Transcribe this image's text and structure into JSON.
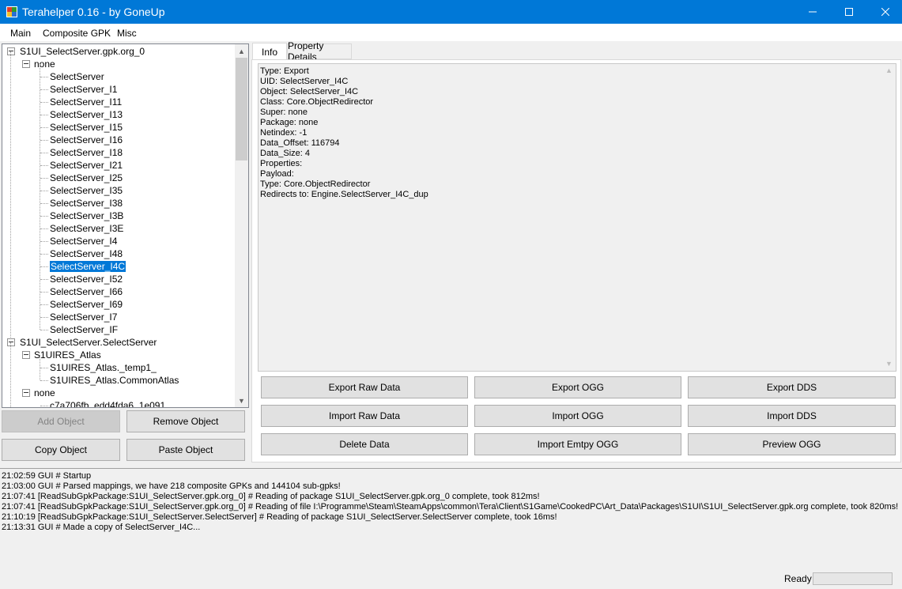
{
  "window": {
    "title": "Terahelper 0.16 - by GoneUp"
  },
  "menu": [
    "Main",
    "Composite GPK",
    "Misc"
  ],
  "tree": {
    "root1": "S1UI_SelectServer.gpk.org_0",
    "root1_child": "none",
    "leaves": [
      "SelectServer",
      "SelectServer_I1",
      "SelectServer_I11",
      "SelectServer_I13",
      "SelectServer_I15",
      "SelectServer_I16",
      "SelectServer_I18",
      "SelectServer_I21",
      "SelectServer_I25",
      "SelectServer_I35",
      "SelectServer_I38",
      "SelectServer_I3B",
      "SelectServer_I3E",
      "SelectServer_I4",
      "SelectServer_I48",
      "SelectServer_I4C",
      "SelectServer_I52",
      "SelectServer_I66",
      "SelectServer_I69",
      "SelectServer_I7",
      "SelectServer_IF"
    ],
    "selected_index": 15,
    "root2": "S1UI_SelectServer.SelectServer",
    "root2_child": "S1UIRES_Atlas",
    "root2_leaves": [
      "S1UIRES_Atlas._temp1_",
      "S1UIRES_Atlas.CommonAtlas"
    ],
    "root2_child2": "none",
    "partial": "c7a706fb_edd4fda6_1e091..."
  },
  "left_buttons": {
    "add": "Add Object",
    "remove": "Remove Object",
    "copy": "Copy Object",
    "paste": "Paste Object"
  },
  "tabs": [
    "Info",
    "Property Details"
  ],
  "info_lines": [
    "Type: Export",
    "UID: SelectServer_I4C",
    "Object: SelectServer_I4C",
    "Class: Core.ObjectRedirector",
    "Super: none",
    "Package: none",
    "Netindex: -1",
    "Data_Offset: 116794",
    "Data_Size: 4",
    "Properties:",
    "Payload:",
    "Type: Core.ObjectRedirector",
    "Redirects to: Engine.SelectServer_I4C_dup"
  ],
  "action_buttons": {
    "export_raw": "Export Raw Data",
    "export_ogg": "Export OGG",
    "export_dds": "Export DDS",
    "import_raw": "Import Raw Data",
    "import_ogg": "Import OGG",
    "import_dds": "Import DDS",
    "delete": "Delete Data",
    "import_empty_ogg": "Import Emtpy OGG",
    "preview_ogg": "Preview OGG"
  },
  "log_lines": [
    "21:02:59 GUI # Startup",
    "21:03:00 GUI # Parsed mappings, we have 218 composite GPKs and 144104 sub-gpks!",
    "21:07:41 [ReadSubGpkPackage:S1UI_SelectServer.gpk.org_0] # Reading of package S1UI_SelectServer.gpk.org_0 complete, took 812ms!",
    "21:07:41 [ReadSubGpkPackage:S1UI_SelectServer.gpk.org_0] # Reading of file I:\\Programme\\Steam\\SteamApps\\common\\Tera\\Client\\S1Game\\CookedPC\\Art_Data\\Packages\\S1UI\\S1UI_SelectServer.gpk.org complete, took 820ms!",
    "21:10:19 [ReadSubGpkPackage:S1UI_SelectServer.SelectServer] # Reading of package S1UI_SelectServer.SelectServer complete, took 16ms!",
    "21:13:31 GUI # Made a copy of SelectServer_I4C..."
  ],
  "status": {
    "text": "Ready"
  },
  "colors": {
    "titlebar": "#0078d7",
    "selection": "#0078d7"
  }
}
